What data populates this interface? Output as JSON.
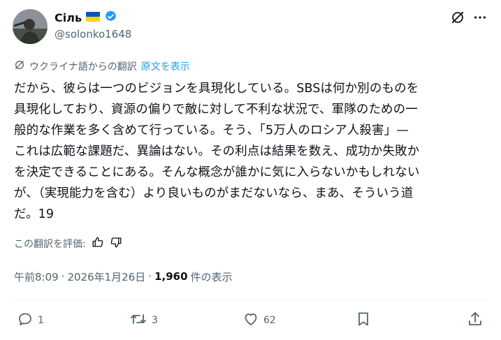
{
  "author": {
    "name": "Сіль",
    "flag_icon": "ukraine-flag-icon",
    "verified_icon": "verified-badge-icon",
    "handle": "@solonko1648"
  },
  "header_icons": [
    "grok-icon",
    "more-icon"
  ],
  "translation": {
    "label": "ウクライナ語からの翻訳",
    "show_original": "原文を表示"
  },
  "body_lines": [
    "だから、彼らは一つのビジョンを具現化している。SBSは何か別のものを",
    "具現化しており、資源の偏りで敵に対して不利な状況で、軍隊のための一",
    "般的な作業を多く含めて行っている。そう、「5万人のロシア人殺害」—",
    "これは広範な課題だ、異論はない。その利点は結果を数え、成功か失敗か",
    "を決定できることにある。そんな概念が誰かに気に入らないかもしれない",
    "が、（実現能力を含む）より良いものがまだないなら、まあ、そういう道",
    "だ。19"
  ],
  "rating": {
    "label": "この翻訳を評価:"
  },
  "meta": {
    "time": "午前8:09",
    "sep1": "·",
    "date": "2026年1月26日",
    "sep2": "·",
    "views_count": "1,960",
    "views_label": "件の表示"
  },
  "actions": {
    "replies": "1",
    "reposts": "3",
    "likes": "62"
  },
  "colors": {
    "text": "#0f1419",
    "secondary": "#536471",
    "link": "#1d9bf0",
    "verified": "#1d9bf0",
    "flag_blue": "#0057b7",
    "flag_yellow": "#ffd700"
  }
}
